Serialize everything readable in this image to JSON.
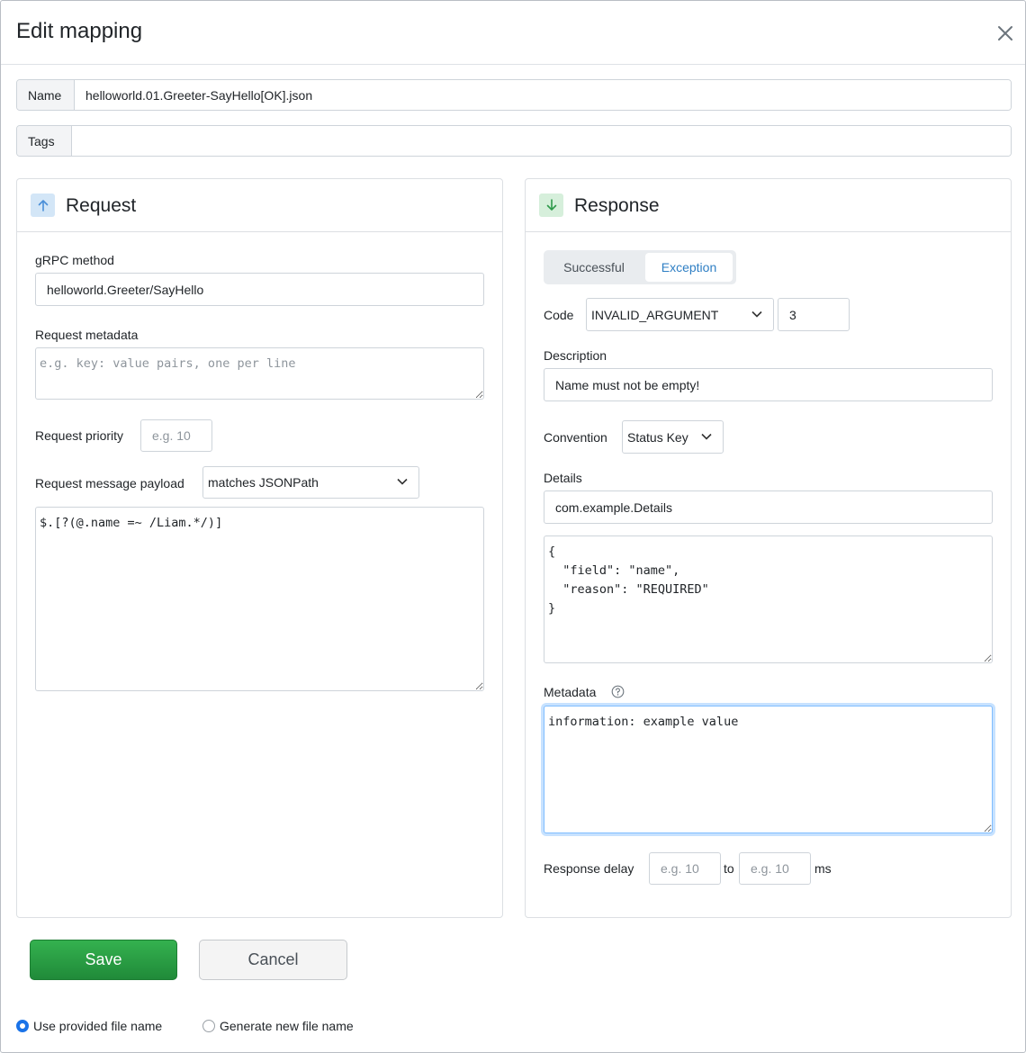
{
  "dialog": {
    "title": "Edit mapping"
  },
  "name_field": {
    "label": "Name",
    "value": "helloworld.01.Greeter-SayHello[OK].json"
  },
  "tags_field": {
    "label": "Tags",
    "value": ""
  },
  "request": {
    "title": "Request",
    "icon": "arrow-up-icon",
    "grpc_method": {
      "label": "gRPC method",
      "value": "helloworld.Greeter/SayHello"
    },
    "metadata": {
      "label": "Request metadata",
      "placeholder": "e.g. key: value pairs, one per line",
      "value": ""
    },
    "priority": {
      "label": "Request priority",
      "placeholder": "e.g. 10",
      "value": ""
    },
    "payload": {
      "label": "Request message payload",
      "matcher": "matches JSONPath",
      "value": "$.[?(@.name =~ /Liam.*/)]"
    }
  },
  "response": {
    "title": "Response",
    "icon": "arrow-down-icon",
    "tabs": [
      "Successful",
      "Exception"
    ],
    "active_tab": "Exception",
    "code": {
      "label": "Code",
      "selected": "INVALID_ARGUMENT",
      "number": "3"
    },
    "description": {
      "label": "Description",
      "value": "Name must not be empty!"
    },
    "convention": {
      "label": "Convention",
      "selected": "Status Key"
    },
    "details": {
      "label": "Details",
      "type": "com.example.Details",
      "json": "{\n  \"field\": \"name\",\n  \"reason\": \"REQUIRED\"\n}"
    },
    "metadata": {
      "label": "Metadata",
      "help_icon": "question-circle-icon",
      "value": "information: example value"
    },
    "delay": {
      "label": "Response delay",
      "from_placeholder": "e.g. 10",
      "to_label": "to",
      "to_placeholder": "e.g. 10",
      "unit": "ms"
    }
  },
  "actions": {
    "save": "Save",
    "cancel": "Cancel"
  },
  "file_name_options": {
    "options": [
      "Use provided file name",
      "Generate new file name"
    ],
    "selected": "Use provided file name"
  },
  "colors": {
    "save_green": "#28a745",
    "focus_blue": "#80bdff",
    "request_icon_bg": "#d6e9f8",
    "response_icon_bg": "#d8f0dd"
  }
}
